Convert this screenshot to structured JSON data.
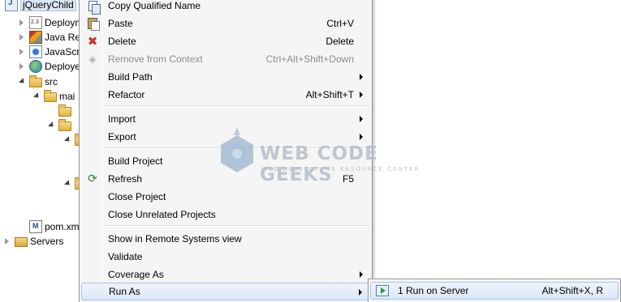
{
  "tree": {
    "project": "jQueryChild",
    "items": [
      {
        "label": "Deploym"
      },
      {
        "label": "Java Res"
      },
      {
        "label": "JavaScri"
      },
      {
        "label": "Deploye"
      },
      {
        "label": "src"
      },
      {
        "label": "mai"
      },
      {
        "label": "pom.xm"
      },
      {
        "label": "Servers"
      }
    ]
  },
  "menu": {
    "items": [
      {
        "label": "Copy Qualified Name",
        "shortcut": "",
        "icon": "copy-icon"
      },
      {
        "label": "Paste",
        "shortcut": "Ctrl+V",
        "icon": "paste-icon"
      },
      {
        "label": "Delete",
        "shortcut": "Delete",
        "icon": "delete-icon"
      },
      {
        "label": "Remove from Context",
        "shortcut": "Ctrl+Alt+Shift+Down",
        "icon": "remove-context-icon",
        "disabled": true
      },
      {
        "label": "Build Path",
        "shortcut": "",
        "submenu": true
      },
      {
        "label": "Refactor",
        "shortcut": "Alt+Shift+T",
        "submenu": true
      },
      {
        "label": "Import",
        "shortcut": "",
        "submenu": true
      },
      {
        "label": "Export",
        "shortcut": "",
        "submenu": true
      },
      {
        "label": "Build Project",
        "shortcut": ""
      },
      {
        "label": "Refresh",
        "shortcut": "F5",
        "icon": "refresh-icon"
      },
      {
        "label": "Close Project",
        "shortcut": ""
      },
      {
        "label": "Close Unrelated Projects",
        "shortcut": ""
      },
      {
        "label": "Show in Remote Systems view",
        "shortcut": ""
      },
      {
        "label": "Validate",
        "shortcut": ""
      },
      {
        "label": "Coverage As",
        "shortcut": "",
        "submenu": true
      },
      {
        "label": "Run As",
        "shortcut": "",
        "submenu": true,
        "highlighted": true
      }
    ]
  },
  "submenu": {
    "items": [
      {
        "label": "1 Run on Server",
        "shortcut": "Alt+Shift+X, R",
        "icon": "run-on-server-icon"
      }
    ]
  },
  "watermark": {
    "title": "WEB CODE GEEKS",
    "subtitle": "WEB DEVELOPERS RESOURCE CENTER"
  }
}
